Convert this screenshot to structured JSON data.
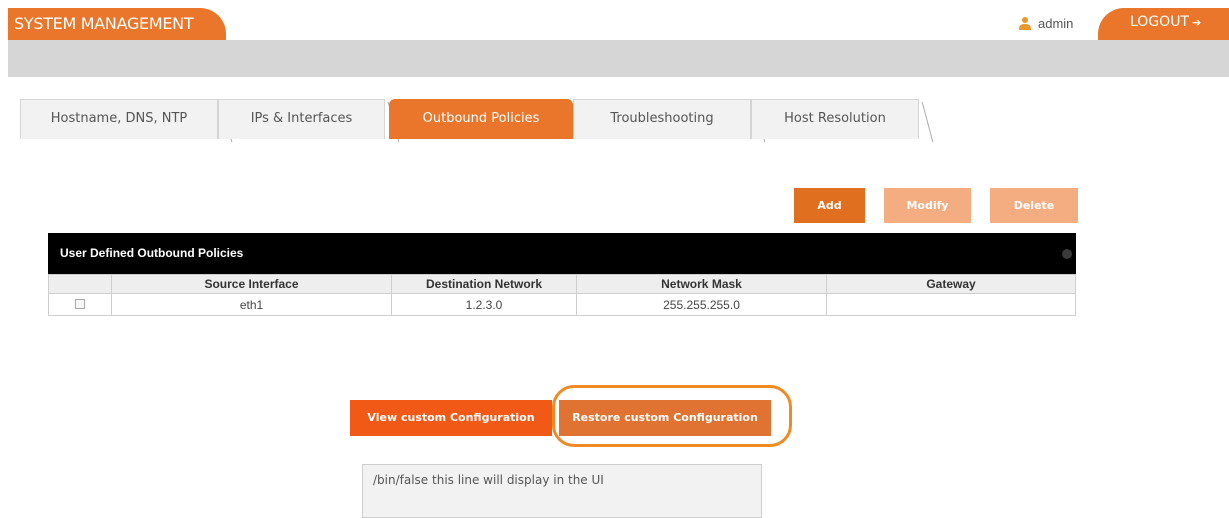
{
  "header": {
    "title": "SYSTEM MANAGEMENT",
    "user_icon": "user-icon",
    "username": "admin",
    "logout_label": "LOGOUT",
    "logout_icon": "logout-icon",
    "accent_color": "#e9762a"
  },
  "tabs": [
    {
      "label": "Hostname, DNS, NTP",
      "active": false
    },
    {
      "label": "IPs & Interfaces",
      "active": false
    },
    {
      "label": "Outbound Policies",
      "active": true
    },
    {
      "label": "Troubleshooting",
      "active": false
    },
    {
      "label": "Host Resolution",
      "active": false
    }
  ],
  "actions": {
    "add_label": "Add",
    "modify_label": "Modify",
    "delete_label": "Delete"
  },
  "grid": {
    "caption": "User Defined Outbound Policies",
    "columns": [
      "",
      "Source Interface",
      "Destination Network",
      "Network Mask",
      "Gateway"
    ],
    "rows": [
      {
        "selected": false,
        "source_interface": "eth1",
        "destination_network": "1.2.3.0",
        "network_mask": "255.255.255.0",
        "gateway": ""
      }
    ]
  },
  "custom": {
    "view_label": "View custom Configuration",
    "restore_label": "Restore custom Configuration",
    "output_text": "/bin/false this line will display in the UI"
  }
}
